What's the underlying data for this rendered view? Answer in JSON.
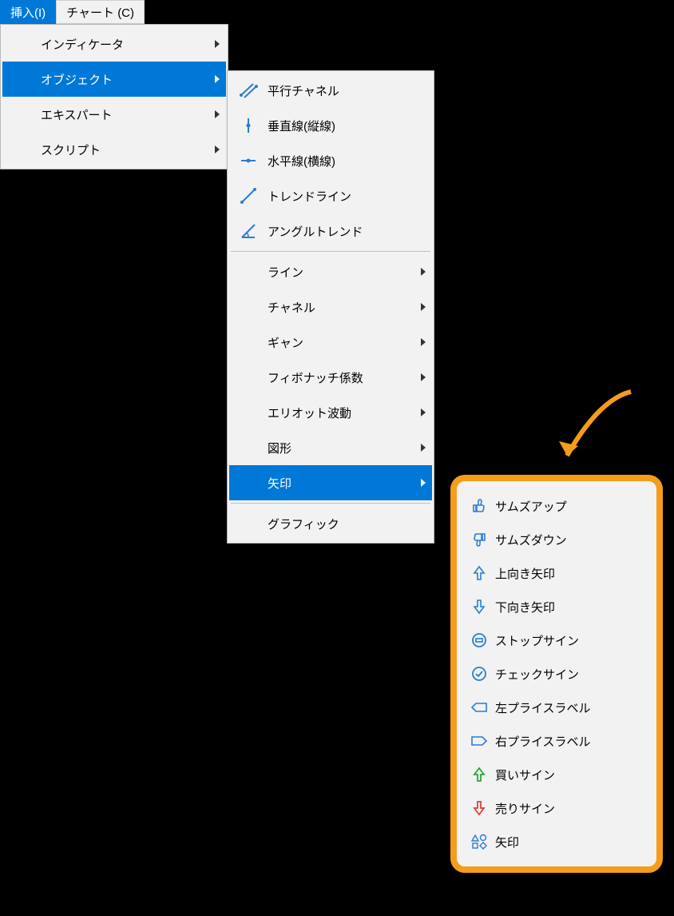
{
  "menubar": {
    "insert": "挿入(I)",
    "chart": "チャート (C)"
  },
  "menu1": {
    "indicators": "インディケータ",
    "objects": "オブジェクト",
    "experts": "エキスパート",
    "scripts": "スクリプト"
  },
  "menu2": {
    "parallel_channel": "平行チャネル",
    "vertical_line": "垂直線(縦線)",
    "horizontal_line": "水平線(横線)",
    "trend_line": "トレンドライン",
    "angle_trend": "アングルトレンド",
    "line": "ライン",
    "channel": "チャネル",
    "gann": "ギャン",
    "fibonacci": "フィボナッチ係数",
    "elliott": "エリオット波動",
    "shapes": "図形",
    "arrows": "矢印",
    "graphics": "グラフィック"
  },
  "menu3": {
    "thumbs_up": "サムズアップ",
    "thumbs_down": "サムズダウン",
    "arrow_up": "上向き矢印",
    "arrow_down": "下向き矢印",
    "stop_sign": "ストップサイン",
    "check_sign": "チェックサイン",
    "left_price": "左プライスラベル",
    "right_price": "右プライスラベル",
    "buy_sign": "買いサイン",
    "sell_sign": "売りサイン",
    "arrow": "矢印"
  }
}
